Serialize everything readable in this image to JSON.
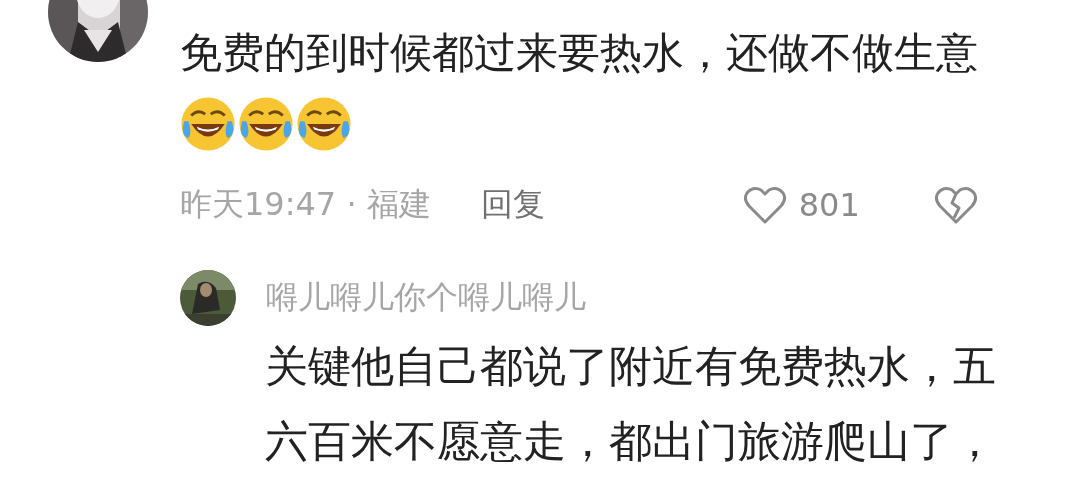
{
  "comment": {
    "text": "免费的到时候都过来要热水，还做不做生意",
    "emojis": [
      {
        "kind": "laugh-cry"
      },
      {
        "kind": "laugh-cry"
      },
      {
        "kind": "laugh-cry"
      }
    ],
    "time": "昨天19:47 · 福建",
    "reply_label": "回复",
    "likes": "801"
  },
  "reply": {
    "author": "嘚儿嘚儿你个嘚儿嘚儿",
    "text": "关键他自己都说了附近有免费热水，五六百米不愿意走，都出门旅游爬山了，"
  }
}
